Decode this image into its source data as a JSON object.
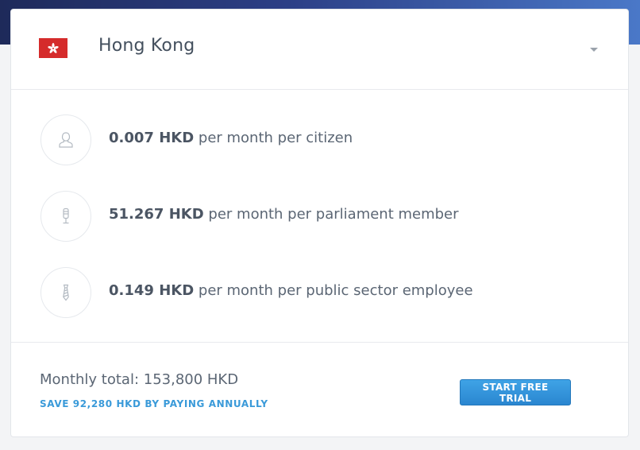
{
  "country_selector": {
    "country_name": "Hong Kong",
    "flag_icon": "hong-kong-flag-icon",
    "flag_color": "#d52b2b"
  },
  "pricing_rows": [
    {
      "icon": "person-icon",
      "amount": "0.007 HKD",
      "description": "per month per citizen"
    },
    {
      "icon": "microphone-icon",
      "amount": "51.267 HKD",
      "description": "per month per parliament member"
    },
    {
      "icon": "necktie-icon",
      "amount": "0.149 HKD",
      "description": "per month per public sector employee"
    }
  ],
  "footer": {
    "monthly_total": "Monthly total: 153,800 HKD",
    "save_link": "SAVE 92,280 HKD BY PAYING ANNUALLY",
    "trial_button": "START FREE TRIAL"
  },
  "colors": {
    "accent": "#3a9ad9",
    "button": "#2a86d0",
    "header_band": "#2c3f86"
  }
}
